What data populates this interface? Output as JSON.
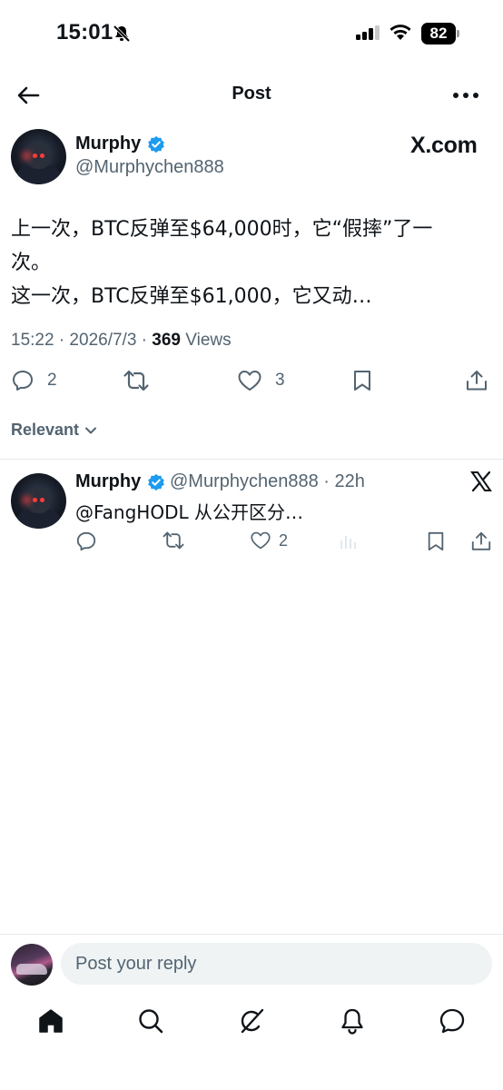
{
  "status_bar": {
    "time": "15:01",
    "battery": "82"
  },
  "nav": {
    "title": "Post"
  },
  "post": {
    "author_name": "Murphy",
    "author_handle": "@Murphychen888",
    "source_badge": "X.com",
    "text_lines": [
      "上一次，BTC反弹至$64,000时，它“假摔”了一",
      "次。",
      "这一次，BTC反弹至$61,000，它又动…"
    ],
    "timestamp": "15:22 · 2026/7/3 · ",
    "views_count": "369",
    "views_label": " Views",
    "replies": "2",
    "likes": "3"
  },
  "sort": {
    "label": "Relevant"
  },
  "reply": {
    "author_name": "Murphy",
    "meta": "@Murphychen888 · 22h",
    "text": "@FangHODL 从公开区分…",
    "likes": "2"
  },
  "composer": {
    "placeholder": "Post your reply"
  },
  "colors": {
    "text": "#0f1419",
    "secondary": "#536471",
    "verified": "#1d9bf0",
    "divider": "#e6e9ec",
    "input_bg": "#eff3f4"
  },
  "icons": {
    "back": "arrow-left-icon",
    "more": "more-horizontal-icon",
    "verified": "verified-badge-icon",
    "reply": "reply-icon",
    "repost": "repost-icon",
    "like": "heart-icon",
    "bookmark": "bookmark-icon",
    "share": "share-icon",
    "analytics": "analytics-icon",
    "home": "home-icon",
    "search": "search-icon",
    "grok": "grok-icon",
    "notifications": "bell-icon",
    "messages": "message-icon"
  }
}
